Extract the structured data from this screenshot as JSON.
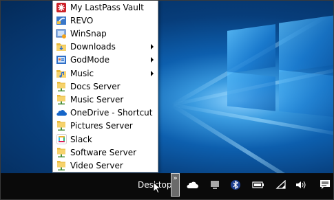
{
  "menu": {
    "items": [
      {
        "label": "My LastPass Vault",
        "icon": "lastpass-icon",
        "submenu": false
      },
      {
        "label": "REVO",
        "icon": "revo-icon",
        "submenu": false
      },
      {
        "label": "WinSnap",
        "icon": "winsnap-icon",
        "submenu": false
      },
      {
        "label": "Downloads",
        "icon": "folder-icon",
        "submenu": true
      },
      {
        "label": "GodMode",
        "icon": "control-panel-icon",
        "submenu": true
      },
      {
        "label": "Music",
        "icon": "music-folder-icon",
        "submenu": true
      },
      {
        "label": "Docs Server",
        "icon": "server-folder-icon",
        "submenu": false
      },
      {
        "label": "Music Server",
        "icon": "server-folder-icon",
        "submenu": false
      },
      {
        "label": "OneDrive - Shortcut",
        "icon": "onedrive-icon",
        "submenu": false
      },
      {
        "label": "Pictures Server",
        "icon": "server-folder-icon",
        "submenu": false
      },
      {
        "label": "Slack",
        "icon": "slack-icon",
        "submenu": false
      },
      {
        "label": "Software Server",
        "icon": "server-folder-icon",
        "submenu": false
      },
      {
        "label": "Video Server",
        "icon": "server-folder-icon",
        "submenu": false
      }
    ]
  },
  "taskbar": {
    "toolbar_label": "Desktop",
    "chevron": "»",
    "tray_icons": [
      "onedrive-cloud-icon",
      "network-device-icon",
      "bluetooth-icon",
      "battery-icon",
      "wifi-icon",
      "volume-icon",
      "action-center-icon"
    ]
  },
  "colors": {
    "taskbar": "#0a0a0a",
    "menu_bg": "#ffffff",
    "desktop": "#0d5fae"
  }
}
